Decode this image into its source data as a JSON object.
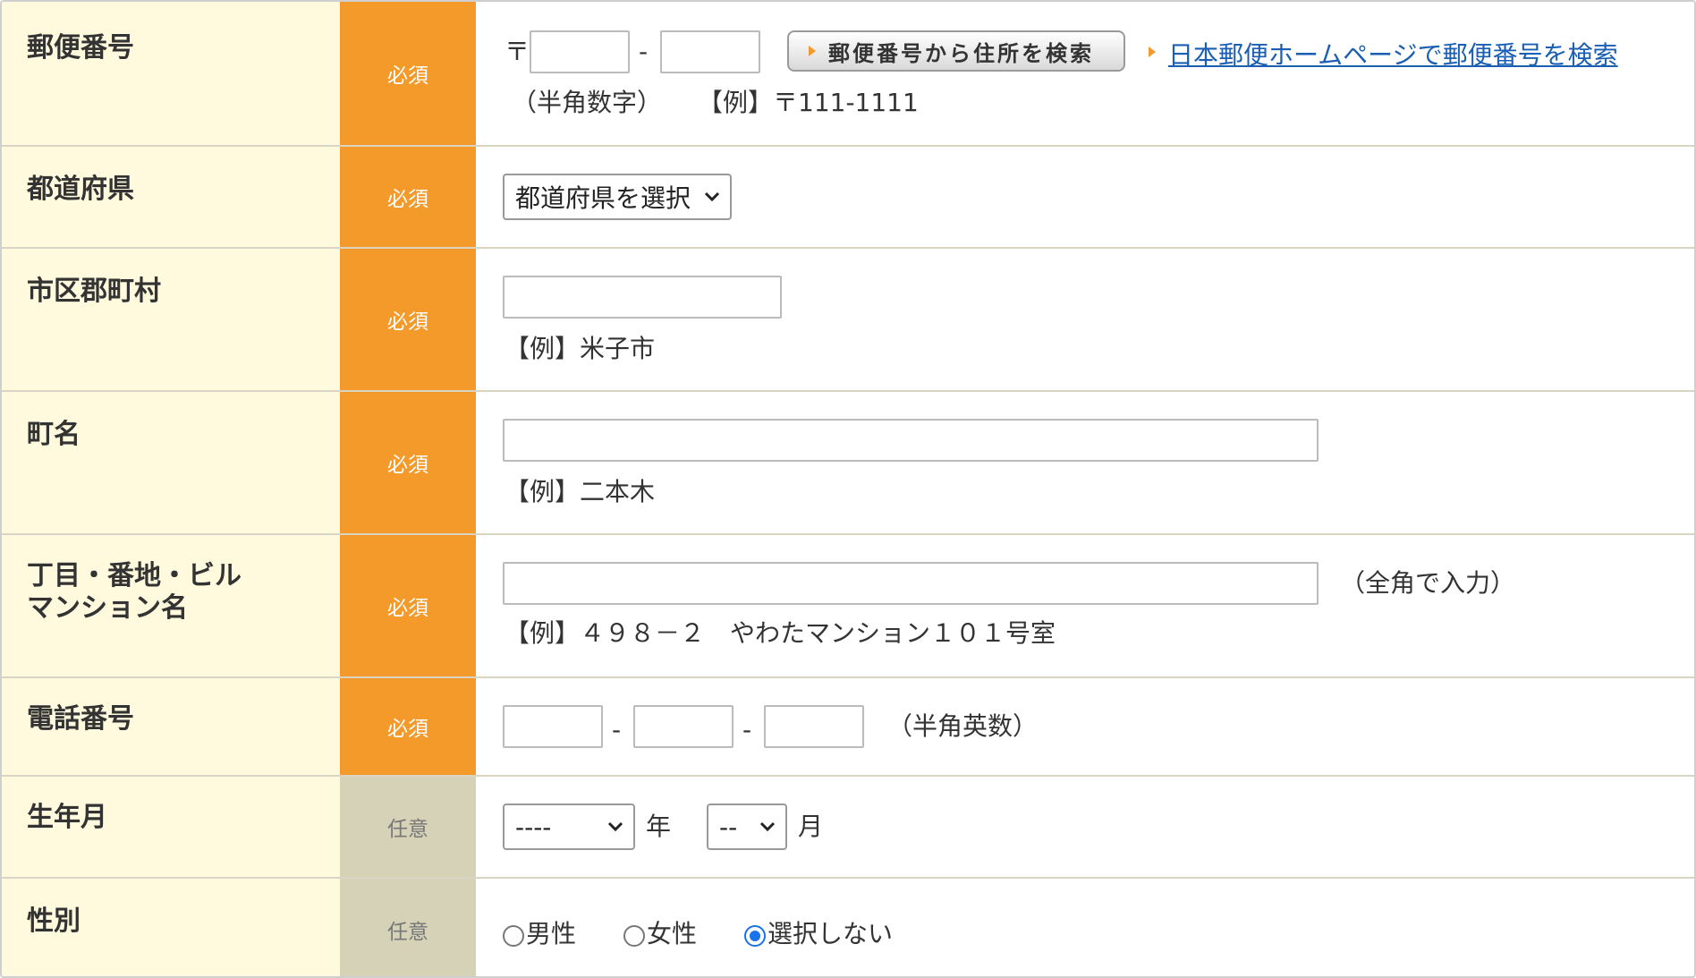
{
  "required_label": "必須",
  "optional_label": "任意",
  "postal": {
    "label": "郵便番号",
    "mark": "〒",
    "dash": "-",
    "search_button": "郵便番号から住所を検索",
    "jp_post_link": "日本郵便ホームページで郵便番号を検索",
    "note": "（半角数字）",
    "example": "【例】〒111-1111"
  },
  "prefecture": {
    "label": "都道府県",
    "selected": "都道府県を選択"
  },
  "city": {
    "label": "市区郡町村",
    "example": "【例】米子市"
  },
  "town": {
    "label": "町名",
    "example": "【例】二本木"
  },
  "address": {
    "label_line1": "丁目・番地・ビル",
    "label_line2": "マンション名",
    "note": "（全角で入力）",
    "example": "【例】４９８－２　やわたマンション１０１号室"
  },
  "phone": {
    "label": "電話番号",
    "dash": "-",
    "note": "（半角英数）"
  },
  "birth": {
    "label": "生年月",
    "year_selected": "----",
    "year_unit": "年",
    "month_selected": "--",
    "month_unit": "月"
  },
  "gender": {
    "label": "性別",
    "options": [
      "男性",
      "女性",
      "選択しない"
    ],
    "selected_index": 2
  },
  "colors": {
    "required_bg": "#f39a2b",
    "optional_bg": "#d5d2b8",
    "label_bg": "#fff9dd",
    "link": "#1a5fb4",
    "radio_selected": "#1a73e8"
  }
}
